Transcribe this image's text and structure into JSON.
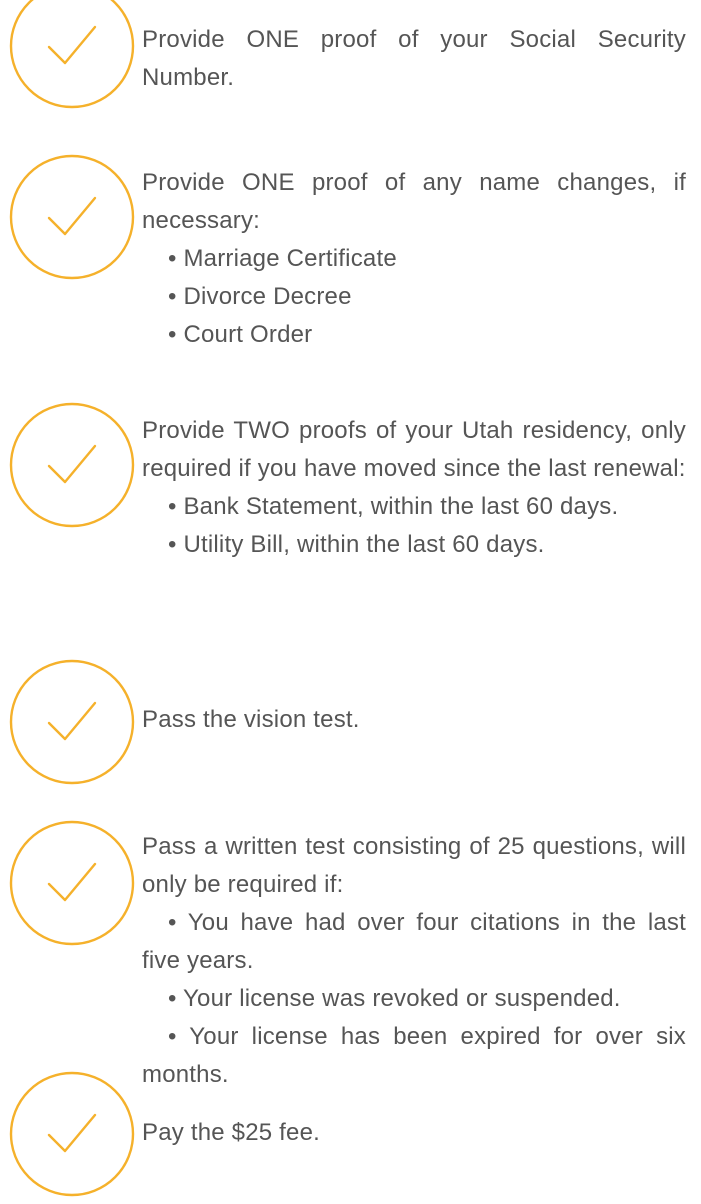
{
  "theme": {
    "accent_color": "#F5B12B",
    "text_color": "#555555",
    "icon": "check-circle-icon"
  },
  "requirements": [
    {
      "text": "Provide ONE proof of your Social Security Number.",
      "bullets": []
    },
    {
      "text": "Provide ONE proof of any name changes, if necessary:",
      "bullets": [
        "• Marriage Certificate",
        "• Divorce Decree",
        "• Court Order"
      ]
    },
    {
      "text": "Provide TWO proofs of your Utah residency, only required if you have moved since the last renewal:",
      "bullets": [
        "• Bank Statement, within the last 60 days.",
        "• Utility Bill, within the last 60 days."
      ]
    },
    {
      "text": "Pass the vision test.",
      "bullets": []
    },
    {
      "text": "Pass a written test consisting of 25 questions, will only be required if:",
      "bullets": [
        "• You have had over four citations in the last five years.",
        "• Your license was revoked or suspended.",
        "• Your license has been expired for over six months."
      ]
    },
    {
      "text": "Pay the $25 fee.",
      "bullets": []
    }
  ]
}
